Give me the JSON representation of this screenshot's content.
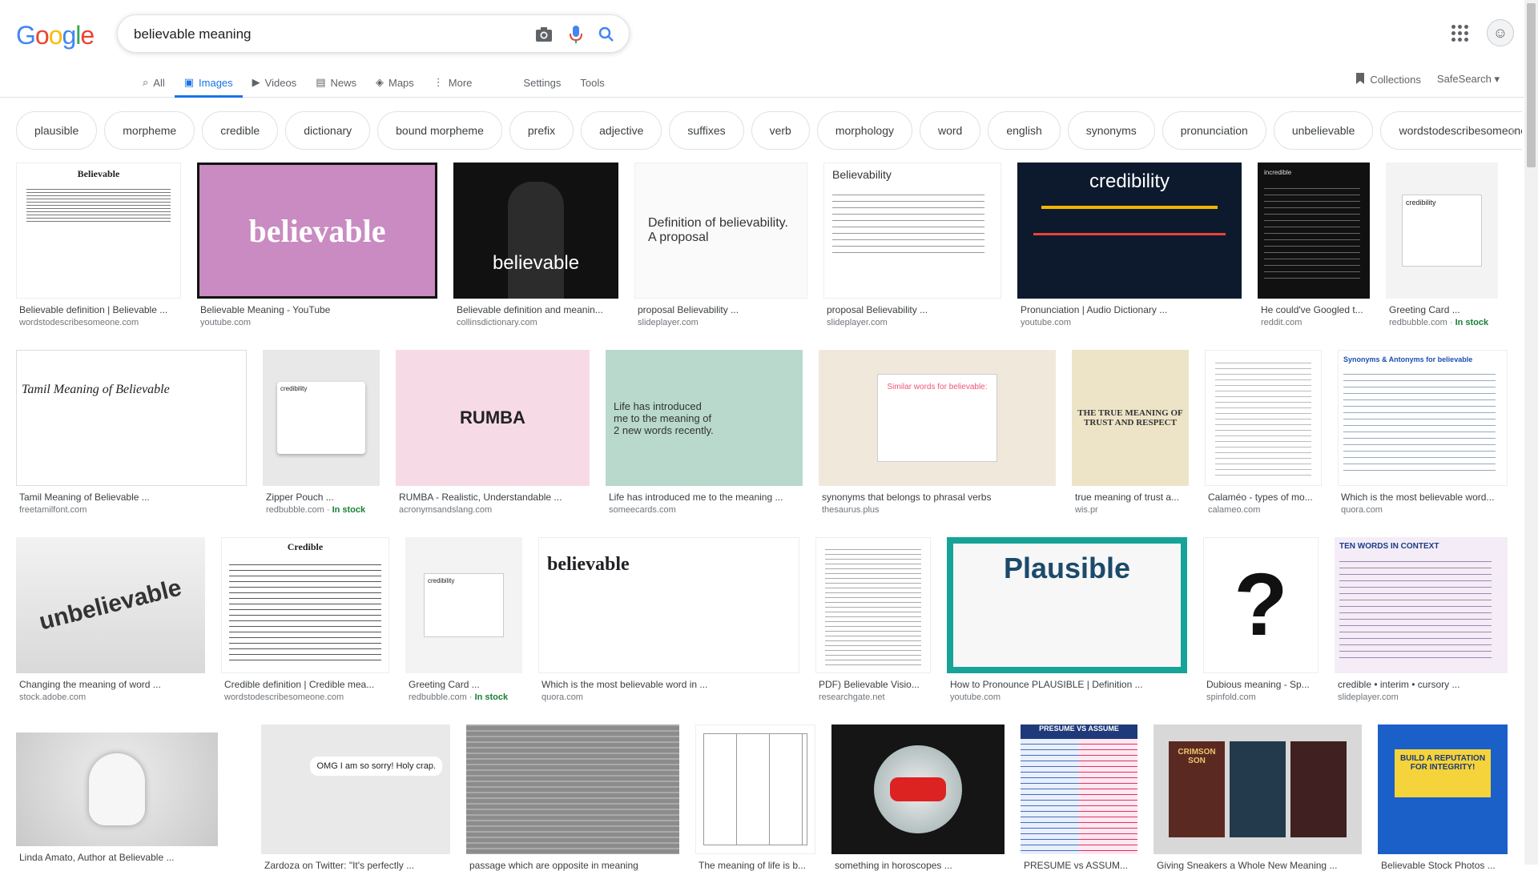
{
  "search": {
    "query": "believable meaning",
    "logo": "Google"
  },
  "tabs": [
    {
      "label": "All",
      "icon": "search-icon",
      "active": false
    },
    {
      "label": "Images",
      "icon": "image-icon",
      "active": true
    },
    {
      "label": "Videos",
      "icon": "video-icon",
      "active": false
    },
    {
      "label": "News",
      "icon": "news-icon",
      "active": false
    },
    {
      "label": "Maps",
      "icon": "map-icon",
      "active": false
    },
    {
      "label": "More",
      "icon": "more-icon",
      "active": false
    }
  ],
  "tools": {
    "settings": "Settings",
    "tools": "Tools"
  },
  "right": {
    "collections": "Collections",
    "safesearch": "SafeSearch"
  },
  "chips": [
    "plausible",
    "morpheme",
    "credible",
    "dictionary",
    "bound morpheme",
    "prefix",
    "adjective",
    "suffixes",
    "verb",
    "morphology",
    "word",
    "english",
    "synonyms",
    "pronunciation",
    "unbelievable",
    "wordstodescribesomeone"
  ],
  "results": {
    "row1": [
      {
        "caption": "Believable definition | Believable ...",
        "source": "wordstodescribesomeone.com",
        "stock": "",
        "thumb_text": "Believable"
      },
      {
        "caption": "Believable Meaning - YouTube",
        "source": "youtube.com",
        "stock": "",
        "thumb_text": "believable"
      },
      {
        "caption": "Believable definition and meanin...",
        "source": "collinsdictionary.com",
        "stock": "",
        "thumb_text": "believable"
      },
      {
        "caption": "proposal Believability ...",
        "source": "slideplayer.com",
        "stock": "",
        "thumb_text": "Definition of believability. A proposal"
      },
      {
        "caption": "proposal Believability ...",
        "source": "slideplayer.com",
        "stock": "",
        "thumb_text": "Believability"
      },
      {
        "caption": "Pronunciation | Audio Dictionary ...",
        "source": "youtube.com",
        "stock": "",
        "thumb_text": "credibility"
      },
      {
        "caption": "He could've Googled t...",
        "source": "reddit.com",
        "stock": "",
        "thumb_text": "incredible"
      },
      {
        "caption": "Greeting Card ...",
        "source": "redbubble.com",
        "stock": "In stock",
        "thumb_text": "credibility"
      }
    ],
    "row2": [
      {
        "caption": "Tamil Meaning of Believable ...",
        "source": "freetamilfont.com",
        "stock": "",
        "thumb_text": "Tamil Meaning of Believable"
      },
      {
        "caption": "Zipper Pouch ...",
        "source": "redbubble.com",
        "stock": "In stock",
        "thumb_text": "credibility"
      },
      {
        "caption": "RUMBA - Realistic, Understandable ...",
        "source": "acronymsandslang.com",
        "stock": "",
        "thumb_text": "RUMBA"
      },
      {
        "caption": "Life has introduced me to the meaning ...",
        "source": "someecards.com",
        "stock": "",
        "thumb_text": "Life has introduced me to the meaning of 2 new words recently."
      },
      {
        "caption": "synonyms that belongs to phrasal verbs",
        "source": "thesaurus.plus",
        "stock": "",
        "thumb_text": "Similar words for believable:"
      },
      {
        "caption": "true meaning of trust a...",
        "source": "wis.pr",
        "stock": "",
        "thumb_text": "THE TRUE MEANING OF TRUST AND RESPECT"
      },
      {
        "caption": "Calaméo - types of mo...",
        "source": "calameo.com",
        "stock": "",
        "thumb_text": ""
      },
      {
        "caption": "Which is the most believable word...",
        "source": "quora.com",
        "stock": "",
        "thumb_text": "Synonyms & Antonyms for believable"
      }
    ],
    "row3": [
      {
        "caption": "Changing the meaning of word ...",
        "source": "stock.adobe.com",
        "stock": "",
        "thumb_text": "unbelievable"
      },
      {
        "caption": "Credible definition | Credible mea...",
        "source": "wordstodescribesomeone.com",
        "stock": "",
        "thumb_text": "Credible"
      },
      {
        "caption": "Greeting Card ...",
        "source": "redbubble.com",
        "stock": "In stock",
        "thumb_text": "credibility"
      },
      {
        "caption": "Which is the most believable word in ...",
        "source": "quora.com",
        "stock": "",
        "thumb_text": "believable"
      },
      {
        "caption": "PDF) Believable Visio...",
        "source": "researchgate.net",
        "stock": "",
        "thumb_text": ""
      },
      {
        "caption": "How to Pronounce PLAUSIBLE | Definition ...",
        "source": "youtube.com",
        "stock": "",
        "thumb_text": "Plausible"
      },
      {
        "caption": "Dubious meaning - Sp...",
        "source": "spinfold.com",
        "stock": "",
        "thumb_text": "?"
      },
      {
        "caption": "credible • interim • cursory ...",
        "source": "slideplayer.com",
        "stock": "",
        "thumb_text": "TEN WORDS IN CONTEXT"
      }
    ],
    "row4": [
      {
        "caption": "Linda Amato, Author at Believable ...",
        "thumb_text": ""
      },
      {
        "caption": "Zardoza on Twitter: \"It's perfectly ...",
        "thumb_text": "OMG I am so sorry! Holy crap."
      },
      {
        "caption": "passage which are opposite in meaning",
        "thumb_text": ""
      },
      {
        "caption": "The meaning of life is b...",
        "thumb_text": ""
      },
      {
        "caption": "something in horoscopes ...",
        "thumb_text": ""
      },
      {
        "caption": "PRESUME vs ASSUM...",
        "thumb_text": "PRESUME VS ASSUME"
      },
      {
        "caption": "Giving Sneakers a Whole New Meaning ...",
        "thumb_text": "CRIMSON SON"
      },
      {
        "caption": "Believable Stock Photos ...",
        "thumb_text": "BUILD A REPUTATION FOR INTEGRITY!"
      }
    ]
  }
}
